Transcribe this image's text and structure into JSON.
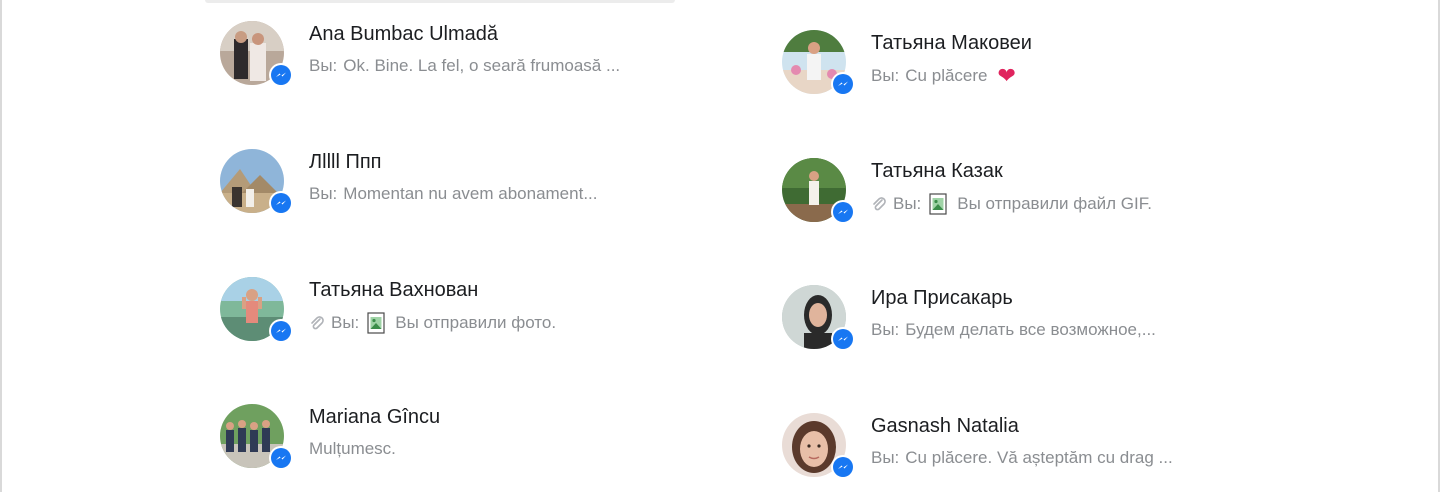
{
  "conversations": [
    {
      "name": "Ana Bumbac Ulmadă",
      "prefix": "Вы:",
      "message": "Ok. Bine. La fel, o seară frumoasă ...",
      "attachment": false,
      "heart": false
    },
    {
      "name": "Лllll Ппп",
      "prefix": "Вы:",
      "message": "Momentan nu avem abonament...",
      "attachment": false,
      "heart": false
    },
    {
      "name": "Татьяна Вахнован",
      "prefix": "Вы:",
      "message": "Вы отправили фото.",
      "attachment": true,
      "heart": false
    },
    {
      "name": "Mariana Gîncu",
      "prefix": "",
      "message": "Mulțumesc.",
      "attachment": false,
      "heart": false
    },
    {
      "name": "Татьяна Маковеи",
      "prefix": "Вы:",
      "message": "Cu plăcere",
      "attachment": false,
      "heart": true
    },
    {
      "name": "Татьяна Казак",
      "prefix": "Вы:",
      "message": "Вы отправили файл GIF.",
      "attachment": true,
      "heart": false
    },
    {
      "name": "Ира Присакарь",
      "prefix": "Вы:",
      "message": "Будем делать все возможное,...",
      "attachment": false,
      "heart": false
    },
    {
      "name": "Gasnash Natalia",
      "prefix": "Вы:",
      "message": "Cu plăcere. Vă așteptăm cu drag ...",
      "attachment": false,
      "heart": false
    }
  ],
  "icons": {
    "badge": "messenger-icon",
    "attachment": "paperclip-icon",
    "file": "image-file-icon",
    "heart": "heart-icon"
  },
  "colors": {
    "accent": "#1877f2",
    "name_text": "#1c1e21",
    "preview_text": "#8a8d91",
    "heart": "#e0245e"
  }
}
